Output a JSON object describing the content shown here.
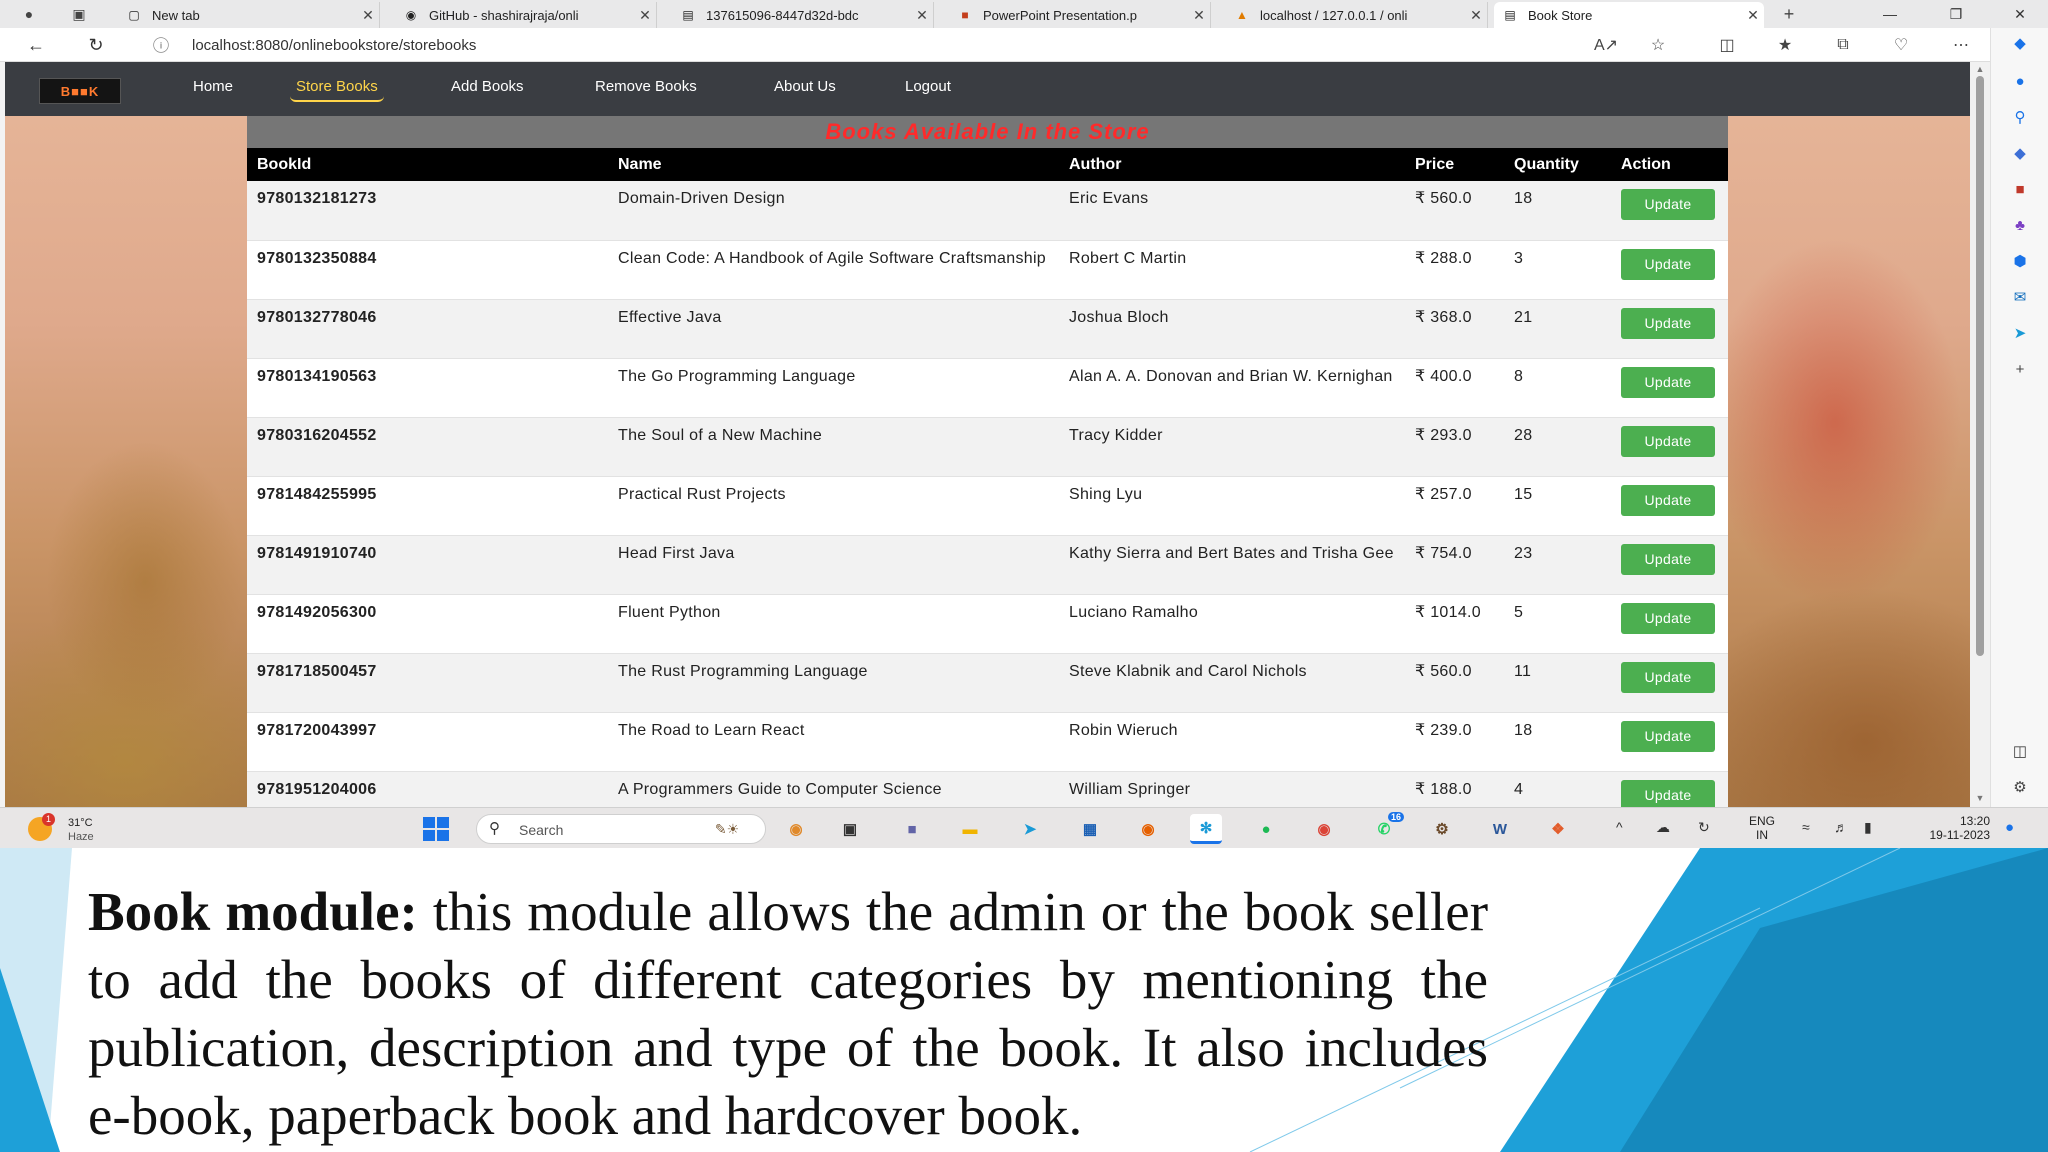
{
  "browser": {
    "tabs": [
      {
        "label": "New tab",
        "icon": "newtab-icon"
      },
      {
        "label": "GitHub - shashirajraja/onli",
        "icon": "github-icon"
      },
      {
        "label": "137615096-8447d32d-bdc",
        "icon": "document-icon"
      },
      {
        "label": "PowerPoint Presentation.p",
        "icon": "powerpoint-icon"
      },
      {
        "label": "localhost / 127.0.0.1 / onli",
        "icon": "phpmyadmin-icon"
      },
      {
        "label": "Book Store",
        "icon": "bookstore-icon"
      }
    ],
    "url": "localhost:8080/onlinebookstore/storebooks"
  },
  "site": {
    "logo": "B■■K",
    "nav": [
      "Home",
      "Store Books",
      "Add Books",
      "Remove Books",
      "About Us",
      "Logout"
    ],
    "active_nav": "Store Books",
    "title": "Books Available In the Store",
    "columns": [
      "BookId",
      "Name",
      "Author",
      "Price",
      "Quantity",
      "Action"
    ],
    "currency": "₹",
    "action_label": "Update",
    "books": [
      {
        "id": "9780132181273",
        "name": "Domain-Driven Design",
        "author": "Eric Evans",
        "price": "₹ 560.0",
        "qty": "18"
      },
      {
        "id": "9780132350884",
        "name": "Clean Code: A Handbook of Agile Software Craftsmanship",
        "author": "Robert C Martin",
        "price": "₹ 288.0",
        "qty": "3"
      },
      {
        "id": "9780132778046",
        "name": "Effective Java",
        "author": "Joshua Bloch",
        "price": "₹ 368.0",
        "qty": "21"
      },
      {
        "id": "9780134190563",
        "name": "The Go Programming Language",
        "author": "Alan A. A. Donovan and Brian W. Kernighan",
        "price": "₹ 400.0",
        "qty": "8"
      },
      {
        "id": "9780316204552",
        "name": "The Soul of a New Machine",
        "author": "Tracy Kidder",
        "price": "₹ 293.0",
        "qty": "28"
      },
      {
        "id": "9781484255995",
        "name": "Practical Rust Projects",
        "author": "Shing Lyu",
        "price": "₹ 257.0",
        "qty": "15"
      },
      {
        "id": "9781491910740",
        "name": "Head First Java",
        "author": "Kathy Sierra and Bert Bates and Trisha Gee",
        "price": "₹ 754.0",
        "qty": "23"
      },
      {
        "id": "9781492056300",
        "name": "Fluent Python",
        "author": "Luciano Ramalho",
        "price": "₹ 1014.0",
        "qty": "5"
      },
      {
        "id": "9781718500457",
        "name": "The Rust Programming Language",
        "author": "Steve Klabnik and Carol Nichols",
        "price": "₹ 560.0",
        "qty": "11"
      },
      {
        "id": "9781720043997",
        "name": "The Road to Learn React",
        "author": "Robin Wieruch",
        "price": "₹ 239.0",
        "qty": "18"
      },
      {
        "id": "9781951204006",
        "name": "A Programmers Guide to Computer Science",
        "author": "William Springer",
        "price": "₹ 188.0",
        "qty": "4"
      }
    ]
  },
  "taskbar": {
    "weather_temp": "31°C",
    "weather_cond": "Haze",
    "weather_badge": "1",
    "search_placeholder": "Search",
    "whatsapp_badge": "16",
    "lang_line1": "ENG",
    "lang_line2": "IN",
    "time": "13:20",
    "date": "19-11-2023"
  },
  "slide": {
    "heading": "Book module:",
    "body": " this module allows the admin or the book seller to add the books of different categories by mentioning the publication, description and type of the book. It also includes e-book, paperback book and hardcover book."
  },
  "colors": {
    "nav_bg": "#3a3d42",
    "active_nav": "#ffd54a",
    "title_red": "#ff2a2a",
    "update_green": "#4caf50",
    "slide_blue": "#1ea0d8"
  }
}
